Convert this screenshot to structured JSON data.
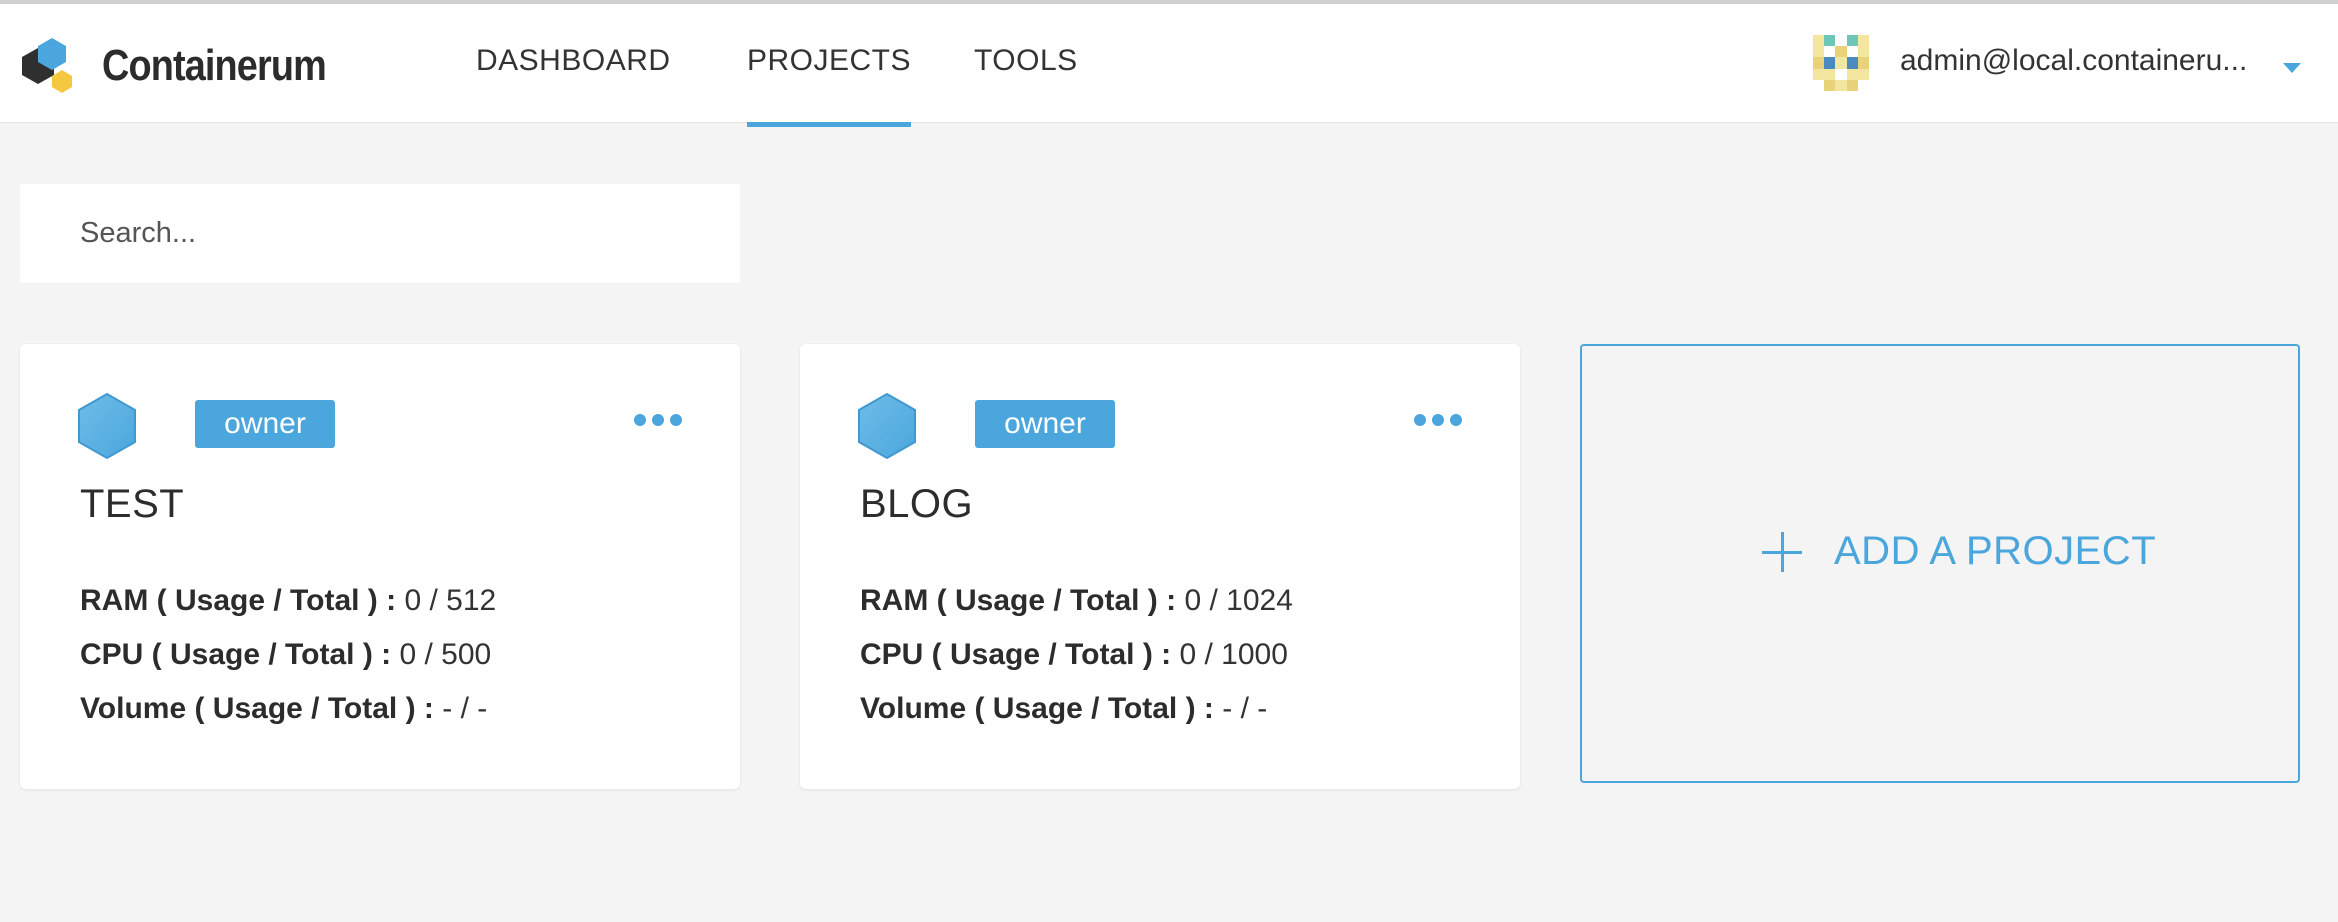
{
  "app": {
    "name": "Containerum"
  },
  "nav": {
    "items": [
      {
        "label": "DASHBOARD",
        "active": false
      },
      {
        "label": "PROJECTS",
        "active": true
      },
      {
        "label": "TOOLS",
        "active": false
      }
    ]
  },
  "user": {
    "email": "admin@local.containeru...",
    "menu_icon": "caret-down-icon"
  },
  "search": {
    "placeholder": "Search..."
  },
  "projects": [
    {
      "name": "TEST",
      "role": "owner",
      "stats": [
        {
          "label": "RAM ( Usage / Total ) :",
          "value": "0 / 512"
        },
        {
          "label": "CPU ( Usage / Total ) :",
          "value": "0 / 500"
        },
        {
          "label": "Volume ( Usage / Total ) :",
          "value": "- / -"
        }
      ]
    },
    {
      "name": "BLOG",
      "role": "owner",
      "stats": [
        {
          "label": "RAM ( Usage / Total ) :",
          "value": "0 / 1024"
        },
        {
          "label": "CPU ( Usage / Total ) :",
          "value": "0 / 1000"
        },
        {
          "label": "Volume ( Usage / Total ) :",
          "value": "- / -"
        }
      ]
    }
  ],
  "add_project": {
    "label": "ADD A PROJECT"
  },
  "colors": {
    "accent": "#4aa6dc",
    "background": "#f4f4f4",
    "card": "#ffffff",
    "text": "#333333",
    "logo_dark": "#2f2f2f",
    "logo_blue": "#4aa6dc",
    "logo_yellow": "#f5c842"
  }
}
